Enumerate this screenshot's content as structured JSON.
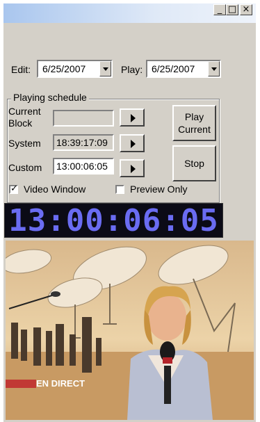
{
  "window": {
    "minimize_glyph": "_",
    "maximize_glyph": "□",
    "close_glyph": "×"
  },
  "edit": {
    "label": "Edit:",
    "value": "6/25/2007"
  },
  "play": {
    "label": "Play:",
    "value": "6/25/2007"
  },
  "schedule": {
    "title": "Playing schedule",
    "current_block": {
      "label": "Current Block",
      "value": ""
    },
    "system": {
      "label": "System",
      "value": "18:39:17:09"
    },
    "custom": {
      "label": "Custom",
      "value": "13:00:06:05"
    },
    "play_current_label": "Play Current",
    "stop_label": "Stop"
  },
  "options": {
    "video_window": {
      "label": "Video Window",
      "checked": true
    },
    "preview_only": {
      "label": "Preview Only",
      "checked": false
    }
  },
  "clock": {
    "time": "13:00:06:05",
    "color": "#6a6cf2"
  },
  "video": {
    "caption": "EN DIRECT",
    "accent": "#c0282c"
  }
}
